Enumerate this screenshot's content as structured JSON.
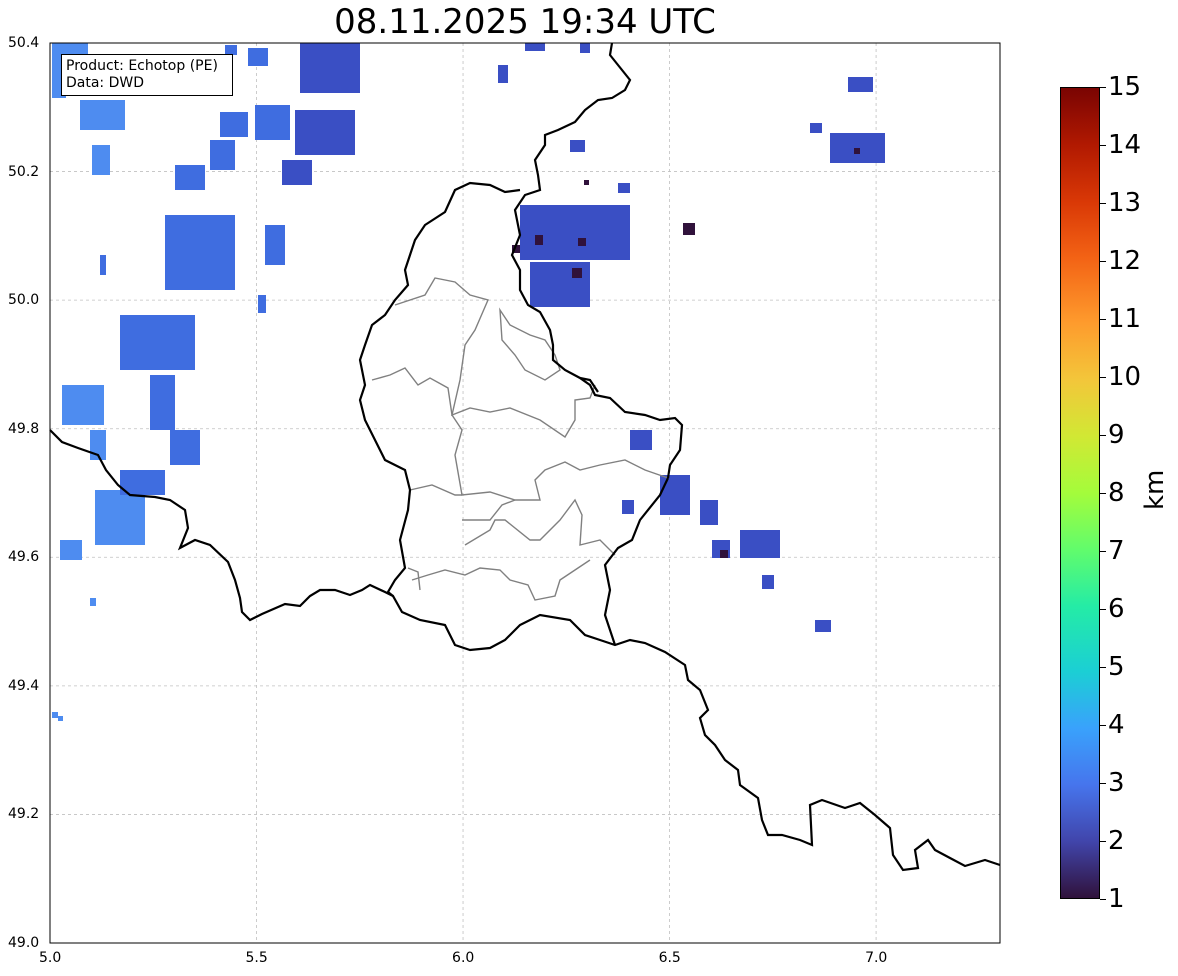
{
  "title": "08.11.2025 19:34 UTC",
  "info": {
    "line1": "Product: Echotop (PE)",
    "line2": "Data: DWD"
  },
  "colorbar": {
    "unit": "km",
    "min": 1,
    "max": 15,
    "ticks": [
      "15",
      "14",
      "13",
      "12",
      "11",
      "10",
      "9",
      "8",
      "7",
      "6",
      "5",
      "4",
      "3",
      "2",
      "1"
    ]
  },
  "axes": {
    "x_ticks": [
      "5.0",
      "5.5",
      "6.0",
      "6.5",
      "7.0"
    ],
    "y_ticks": [
      "50.4",
      "50.2",
      "50.0",
      "49.8",
      "49.6",
      "49.4",
      "49.2",
      "49.0"
    ],
    "xlim": [
      5.0,
      7.3
    ],
    "ylim": [
      49.0,
      50.4
    ],
    "grid": true
  },
  "colors": {
    "border": "#000000",
    "cantons": "#808080",
    "echo_low": "#4675ed",
    "echo_mid": "#3e4fc0",
    "echo_dark": "#30123b"
  }
}
